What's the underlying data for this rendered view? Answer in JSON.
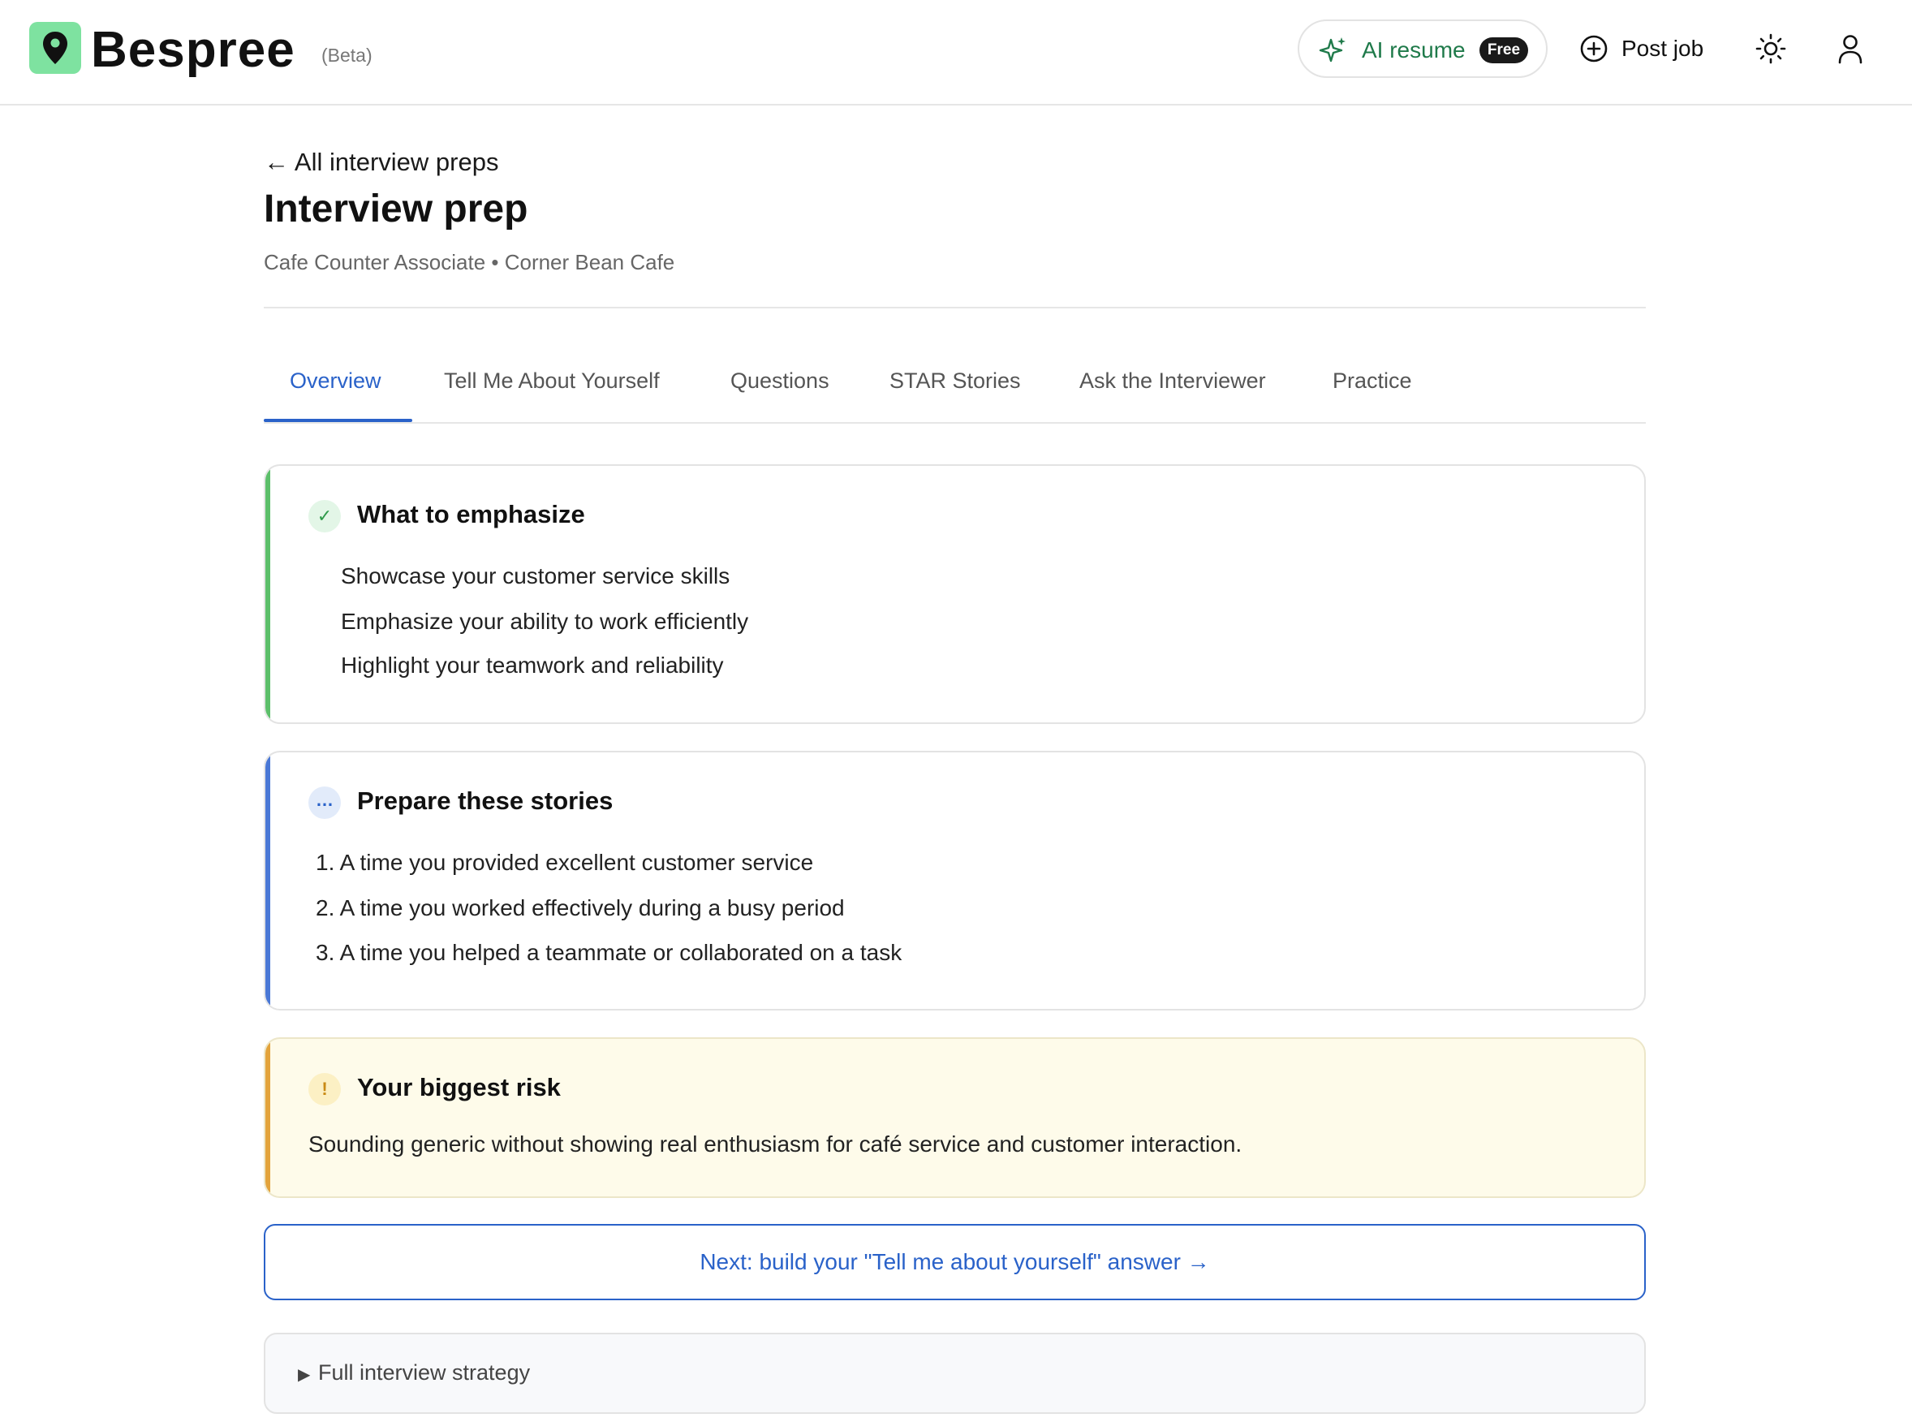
{
  "header": {
    "brand": "Bespree",
    "beta": "(Beta)",
    "ai_resume_label": "AI resume",
    "ai_resume_badge": "Free",
    "post_job_label": "Post job",
    "icons": [
      "map-pin-icon",
      "sparkle-icon",
      "plus-circle-icon",
      "sun-icon",
      "user-icon"
    ]
  },
  "page": {
    "back_link": "← All interview preps",
    "title": "Interview prep",
    "subtitle": "Cafe Counter Associate • Corner Bean Cafe"
  },
  "tabs": [
    {
      "label": "Overview",
      "active": true
    },
    {
      "label": "Tell Me About Yourself",
      "active": false
    },
    {
      "label": "Questions",
      "active": false
    },
    {
      "label": "STAR Stories",
      "active": false
    },
    {
      "label": "Ask the Interviewer",
      "active": false
    },
    {
      "label": "Practice",
      "active": false
    }
  ],
  "emphasize": {
    "badge": "✓",
    "title": "What to emphasize",
    "items": [
      "Showcase your customer service skills",
      "Emphasize your ability to work efficiently",
      "Highlight your teamwork and reliability"
    ]
  },
  "stories": {
    "badge": "…",
    "title": "Prepare these stories",
    "items": [
      "1. A time you provided excellent customer service",
      "2. A time you worked effectively during a busy period",
      "3. A time you helped a teammate or collaborated on a task"
    ]
  },
  "risk": {
    "badge": "!",
    "title": "Your biggest risk",
    "text": "Sounding generic without showing real enthusiasm for café service and customer interaction."
  },
  "next_button": "Next: build your \"Tell me about yourself\" answer →",
  "strategy": {
    "toggle": "▶",
    "label": "Full interview strategy"
  },
  "colors": {
    "accent_blue": "#2a62c9",
    "accent_green": "#5cbf6a",
    "accent_orange": "#e3a33b",
    "risk_bg": "#fefbea",
    "logo_green": "#7ee2a0"
  }
}
